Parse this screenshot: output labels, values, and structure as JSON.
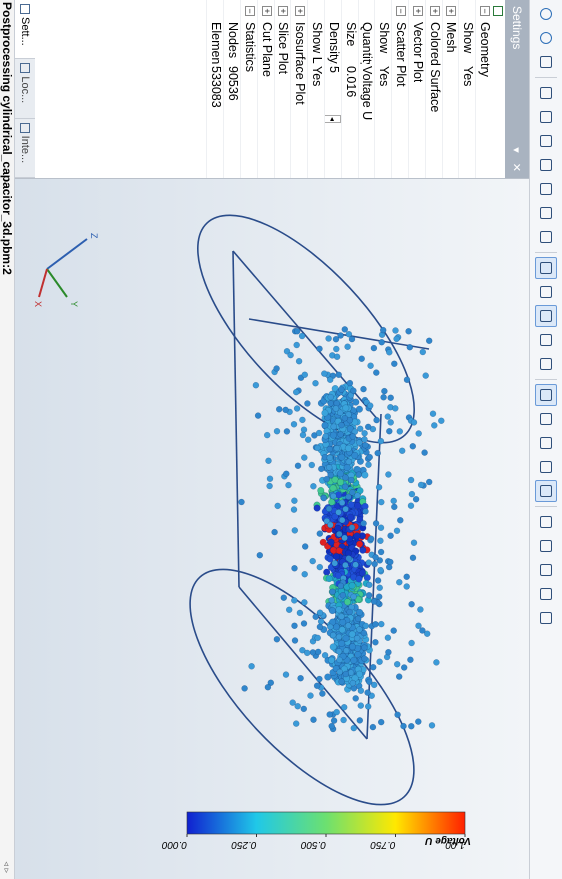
{
  "toolbar": {
    "tools": [
      {
        "name": "zoom-in",
        "active": false
      },
      {
        "name": "zoom-out",
        "active": false
      },
      {
        "name": "zoom-fit",
        "active": false
      },
      {
        "name": "isometric-view",
        "active": false
      },
      {
        "name": "front-view",
        "active": false
      },
      {
        "name": "back-view",
        "active": false
      },
      {
        "name": "left-view",
        "active": false
      },
      {
        "name": "right-view",
        "active": false
      },
      {
        "name": "top-view",
        "active": false
      },
      {
        "name": "bottom-view",
        "active": false
      },
      {
        "name": "select-mode",
        "active": true
      },
      {
        "name": "settings-panel",
        "active": false
      },
      {
        "name": "highlight-tool",
        "active": true
      },
      {
        "name": "screenshot-tool",
        "active": false
      },
      {
        "name": "integral-tool",
        "active": false
      },
      {
        "name": "wireframe-tool",
        "active": true
      },
      {
        "name": "mesh-tool",
        "active": false
      },
      {
        "name": "surface-tool",
        "active": false
      },
      {
        "name": "particle-tool",
        "active": false
      },
      {
        "name": "scatter-tool",
        "active": true
      },
      {
        "name": "color-tool",
        "active": false
      },
      {
        "name": "slice-tool",
        "active": false
      },
      {
        "name": "cut-tool",
        "active": false
      },
      {
        "name": "plane-tool",
        "active": false
      },
      {
        "name": "chart-tool",
        "active": false
      }
    ]
  },
  "settings": {
    "title": "Settings",
    "pin_glyph": "▾",
    "close_glyph": "✕",
    "rows": [
      {
        "type": "cat",
        "exp": "−",
        "name": "Geometry"
      },
      {
        "type": "sub",
        "name": "Show",
        "value": "Yes"
      },
      {
        "type": "cat",
        "exp": "+",
        "name": "Mesh"
      },
      {
        "type": "cat",
        "exp": "+",
        "name": "Colored Surface"
      },
      {
        "type": "cat",
        "exp": "+",
        "name": "Vector Plot"
      },
      {
        "type": "cat",
        "exp": "−",
        "name": "Scatter Plot"
      },
      {
        "type": "sub",
        "name": "Show",
        "value": "Yes"
      },
      {
        "type": "sub",
        "name": "Quantity",
        "value": "Voltage U"
      },
      {
        "type": "sub",
        "name": "Size",
        "value": "0.016"
      },
      {
        "type": "sub",
        "name": "Density, %",
        "value": "5",
        "spin": true
      },
      {
        "type": "sub",
        "name": "Show Legen",
        "value": "Yes"
      },
      {
        "type": "cat",
        "exp": "+",
        "name": "Isosurface Plot"
      },
      {
        "type": "cat",
        "exp": "+",
        "name": "Slice Plot"
      },
      {
        "type": "cat",
        "exp": "+",
        "name": "Cut Plane"
      },
      {
        "type": "cat",
        "exp": "−",
        "name": "Statistics"
      },
      {
        "type": "sub",
        "name": "Nodes",
        "value": "90536"
      },
      {
        "type": "sub",
        "name": "Elements",
        "value": "533083"
      }
    ]
  },
  "tabs": [
    {
      "label": "Sett...",
      "active": true,
      "icon": "settings-tab-icon"
    },
    {
      "label": "Loc...",
      "active": false,
      "icon": "local-tab-icon"
    },
    {
      "label": "Inte...",
      "active": false,
      "icon": "integral-tab-icon"
    }
  ],
  "status": {
    "text": "Postprocessing cylindrical_capacitor_3d.pbm:2",
    "scroll_arrows": "◃ ▹"
  },
  "legend": {
    "title": "Voltage U",
    "ticks": [
      "1.00",
      "0.750",
      "0.500",
      "0.250",
      "0.000"
    ],
    "colors": [
      "#ff2000",
      "#ffe800",
      "#6ce070",
      "#20c8e8",
      "#1020d0"
    ]
  },
  "axes": {
    "labels": [
      "Z",
      "Y",
      "X"
    ],
    "colors": [
      "#2d5fb0",
      "#2a8a2a",
      "#c03030"
    ]
  }
}
